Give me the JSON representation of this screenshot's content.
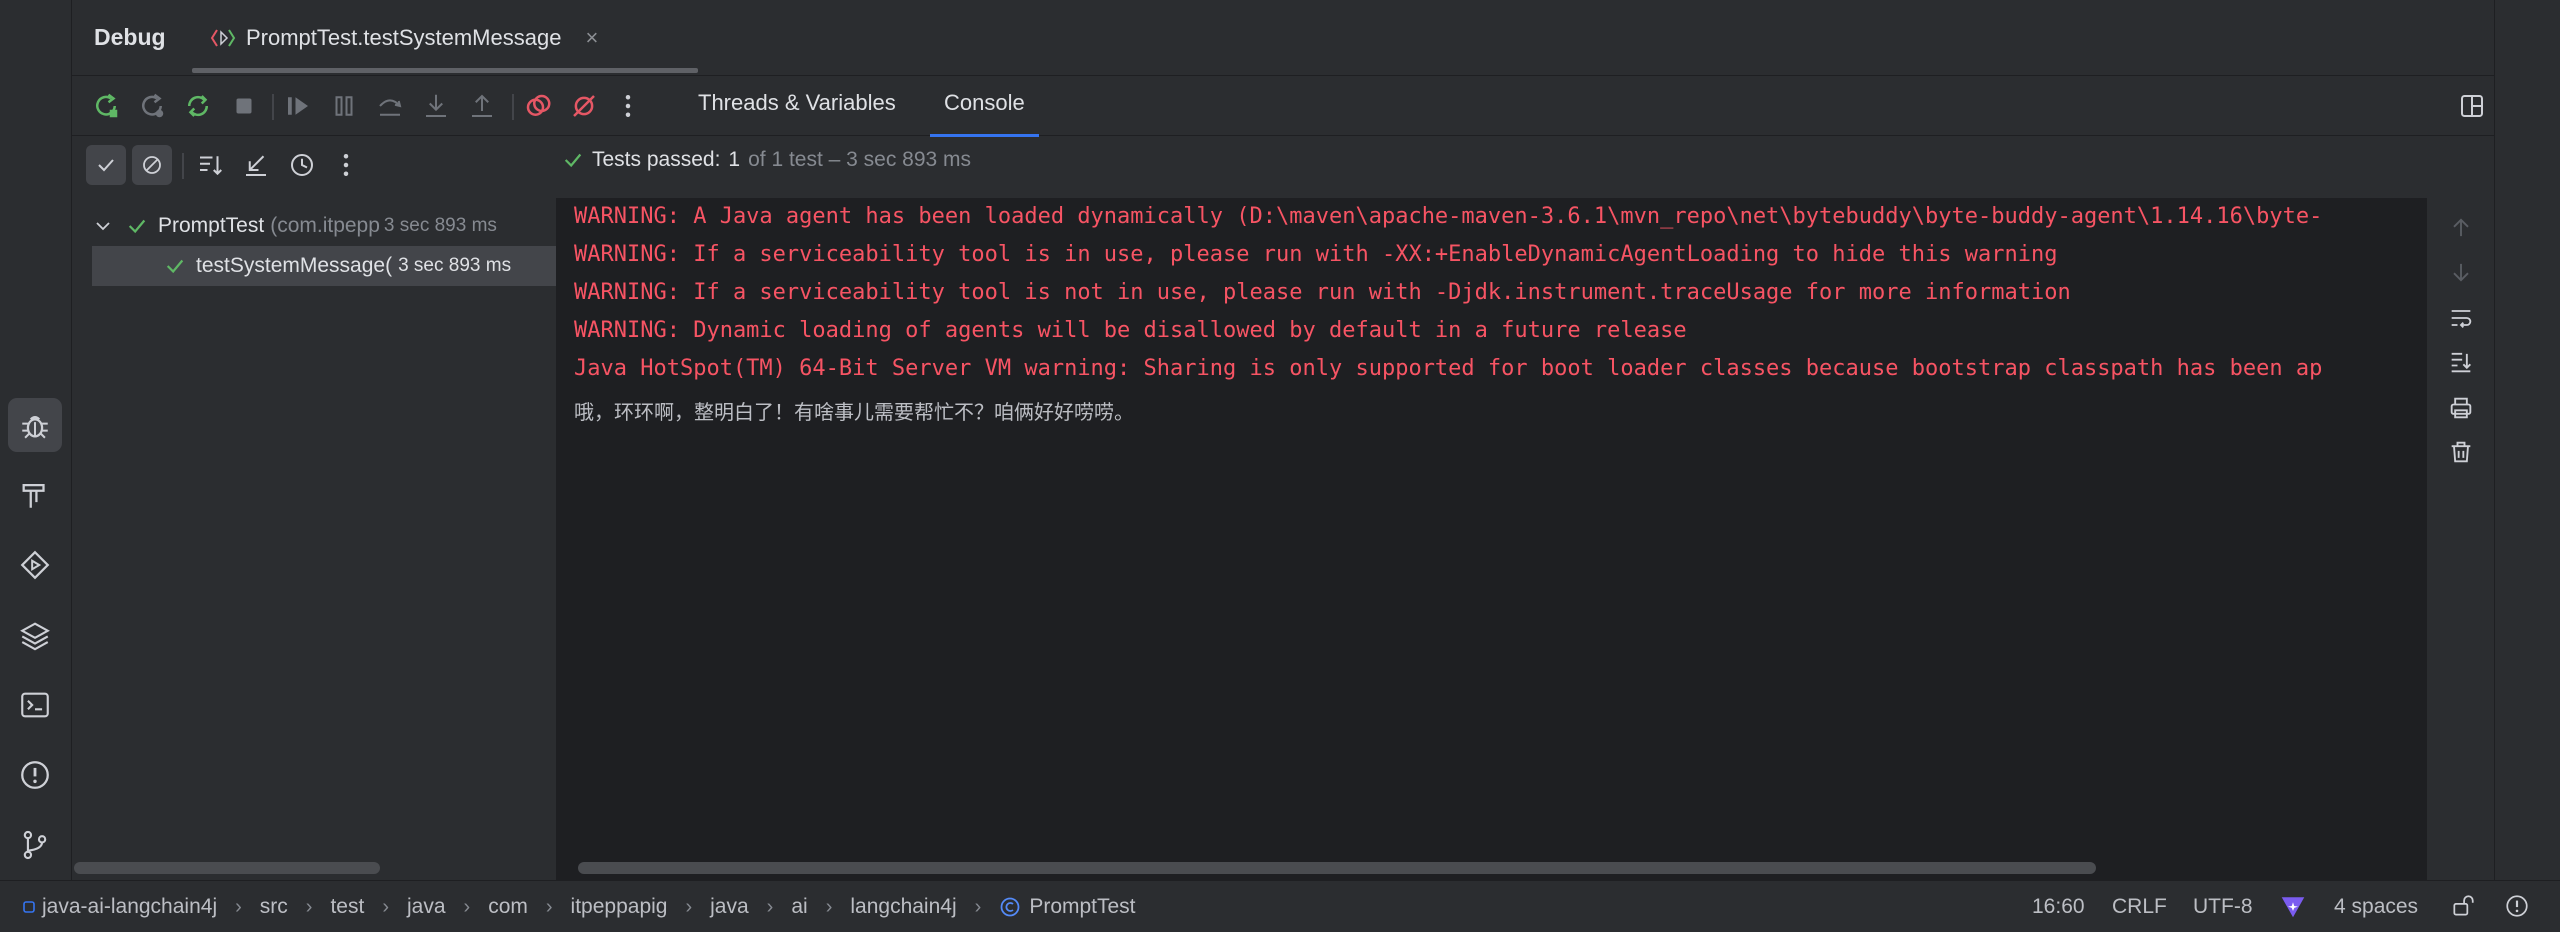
{
  "header": {
    "title": "Debug",
    "tab_label": "PromptTest.testSystemMessage",
    "tab_close": "×"
  },
  "views": {
    "threads": "Threads & Variables",
    "console": "Console"
  },
  "test_status": {
    "prefix": "Tests passed:",
    "passed": "1",
    "suffix": "of 1 test – 3 sec 893 ms"
  },
  "tree": {
    "root": {
      "name": "PromptTest",
      "package": "(com.itpepp",
      "time": "3 sec 893 ms"
    },
    "child": {
      "name": "testSystemMessage(",
      "time": "3 sec 893 ms"
    }
  },
  "console": {
    "lines": [
      "WARNING: A Java agent has been loaded dynamically (D:\\maven\\apache-maven-3.6.1\\mvn_repo\\net\\bytebuddy\\byte-buddy-agent\\1.14.16\\byte-",
      "WARNING: If a serviceability tool is in use, please run with -XX:+EnableDynamicAgentLoading to hide this warning",
      "WARNING: If a serviceability tool is not in use, please run with -Djdk.instrument.traceUsage for more information",
      "WARNING: Dynamic loading of agents will be disallowed by default in a future release",
      "Java HotSpot(TM) 64-Bit Server VM warning: Sharing is only supported for boot loader classes because bootstrap classpath has been ap"
    ],
    "output": "哦，环环啊，整明白了！有啥事儿需要帮忙不？咱俩好好唠唠。"
  },
  "breadcrumbs": [
    "java-ai-langchain4j",
    "src",
    "test",
    "java",
    "com",
    "itpeppapig",
    "java",
    "ai",
    "langchain4j",
    "PromptTest"
  ],
  "statusbar": {
    "position": "16:60",
    "line_ending": "CRLF",
    "encoding": "UTF-8",
    "indent": "4 spaces"
  },
  "colors": {
    "accent": "#3574f0",
    "pass_green": "#5fb865",
    "error_red": "#f75464",
    "panel": "#2b2d30",
    "editor": "#1e1f22"
  }
}
